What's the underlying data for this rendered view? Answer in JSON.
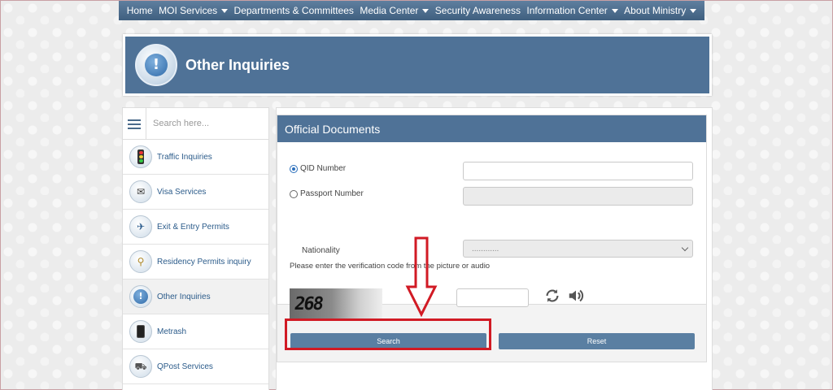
{
  "nav": {
    "items": [
      {
        "label": "Home",
        "dropdown": false
      },
      {
        "label": "MOI Services",
        "dropdown": true
      },
      {
        "label": "Departments & Committees",
        "dropdown": false
      },
      {
        "label": "Media Center",
        "dropdown": true
      },
      {
        "label": "Security Awareness",
        "dropdown": false
      },
      {
        "label": "Information Center",
        "dropdown": true
      },
      {
        "label": "About Ministry",
        "dropdown": true
      }
    ]
  },
  "header": {
    "title": "Other Inquiries",
    "icon": "exclamation-bubble-icon"
  },
  "sidebar": {
    "search_placeholder": "Search here...",
    "items": [
      {
        "label": "Traffic Inquiries",
        "icon": "traffic-light-icon",
        "active": false
      },
      {
        "label": "Visa Services",
        "icon": "visa-stamp-icon",
        "active": false
      },
      {
        "label": "Exit & Entry Permits",
        "icon": "airplane-icon",
        "active": false
      },
      {
        "label": "Residency Permits inquiry",
        "icon": "residency-search-icon",
        "active": false
      },
      {
        "label": "Other Inquiries",
        "icon": "exclamation-icon",
        "active": true
      },
      {
        "label": "Metrash",
        "icon": "phone-icon",
        "active": false
      },
      {
        "label": "QPost Services",
        "icon": "post-truck-icon",
        "active": false
      }
    ]
  },
  "form": {
    "title": "Official Documents",
    "qid_label": "QID Number",
    "qid_value": "",
    "passport_label": "Passport Number",
    "passport_value": "",
    "selected_option": "QID Number",
    "nationality_label": "Nationality",
    "nationality_value": "............",
    "verify_text": "Please enter the verification code from the picture or audio",
    "captcha_text": "268",
    "captcha_value": "",
    "search_label": "Search",
    "reset_label": "Reset"
  },
  "colors": {
    "brand_blue": "#4f7297",
    "button_blue": "#5a7fa2",
    "annotation_red": "#d11a24"
  }
}
